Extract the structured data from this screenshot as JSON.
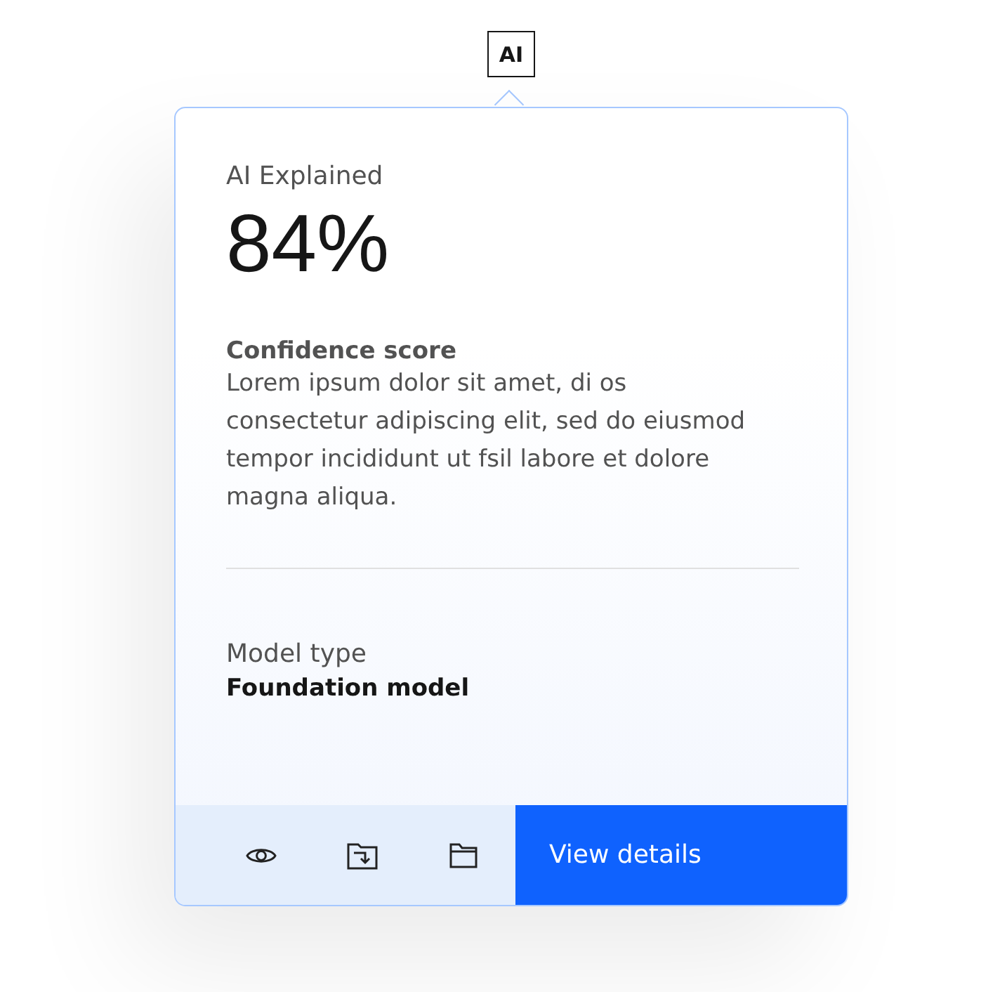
{
  "badge": "AI",
  "eyebrow": "AI Explained",
  "score": "84%",
  "description": {
    "title": "Confidence score",
    "body": "Lorem ipsum dolor sit amet, di os consectetur adipiscing elit, sed do eiusmod tempor incididunt ut fsil labore et dolore magna aliqua."
  },
  "model": {
    "label": "Model type",
    "value": "Foundation model"
  },
  "actions": [
    {
      "kind": "view"
    },
    {
      "kind": "import"
    },
    {
      "kind": "folder"
    }
  ],
  "primary_button": "View details"
}
